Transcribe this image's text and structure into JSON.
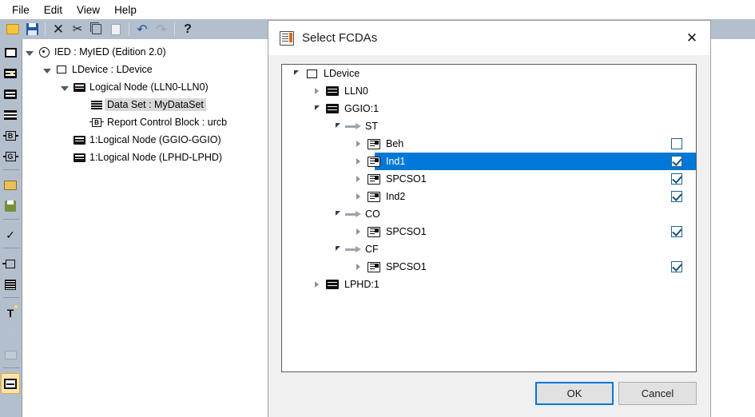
{
  "menubar": {
    "items": [
      {
        "label": "File"
      },
      {
        "label": "Edit"
      },
      {
        "label": "View"
      },
      {
        "label": "Help"
      }
    ]
  },
  "toolbar": {
    "buttons": [
      {
        "name": "open-folder-icon",
        "label": ""
      },
      {
        "name": "save-icon",
        "label": ""
      },
      {
        "name": "delete-icon",
        "label": "✕"
      },
      {
        "name": "cut-icon",
        "label": "✂"
      },
      {
        "name": "copy-icon",
        "label": ""
      },
      {
        "name": "paste-icon",
        "label": ""
      },
      {
        "name": "undo-icon",
        "label": "↶"
      },
      {
        "name": "redo-icon",
        "label": "↷"
      },
      {
        "name": "help-icon",
        "label": "?"
      }
    ]
  },
  "palette": {
    "items": [
      {
        "name": "new-substation-icon"
      },
      {
        "name": "new-folder-icon"
      },
      {
        "name": "folder-icon"
      },
      {
        "name": "data-set-icon"
      },
      {
        "name": "report-control-block-icon"
      },
      {
        "name": "goose-control-block-icon"
      },
      {
        "name": "open-file-icon"
      },
      {
        "name": "save-file-icon"
      },
      {
        "name": "validate-icon"
      },
      {
        "name": "port-icon"
      },
      {
        "name": "table-icon"
      },
      {
        "name": "text-icon"
      },
      {
        "name": "scissors-icon"
      },
      {
        "name": "open-folder-dim-icon"
      },
      {
        "name": "window-icon"
      }
    ]
  },
  "background_tree": {
    "rows": [
      {
        "label": "IED : MyIED (Edition 2.0)",
        "indent": 0,
        "twisty": "open",
        "icon": "ied-icon",
        "selected": false
      },
      {
        "label": "LDevice : LDevice",
        "indent": 1,
        "twisty": "open",
        "icon": "ldevice-icon",
        "selected": false
      },
      {
        "label": "Logical Node (LLN0-LLN0)",
        "indent": 2,
        "twisty": "open",
        "icon": "logical-node-icon",
        "selected": false
      },
      {
        "label": "Data Set : MyDataSet",
        "indent": 3,
        "twisty": "none",
        "icon": "data-set-icon",
        "selected": true
      },
      {
        "label": "Report Control Block : urcb",
        "indent": 3,
        "twisty": "none",
        "icon": "report-control-block-icon",
        "selected": false
      },
      {
        "label": "1:Logical Node (GGIO-GGIO)",
        "indent": 2,
        "twisty": "none",
        "icon": "logical-node-icon",
        "selected": false
      },
      {
        "label": "1:Logical Node (LPHD-LPHD)",
        "indent": 2,
        "twisty": "none",
        "icon": "logical-node-icon",
        "selected": false
      }
    ]
  },
  "dialog": {
    "title": "Select FCDAs",
    "close_label": "✕",
    "tree": {
      "rows": [
        {
          "label": "LDevice",
          "indent": 0,
          "twisty": "open",
          "icon": "ldevice-icon",
          "checkbox": "none",
          "selected": false
        },
        {
          "label": "LLN0",
          "indent": 1,
          "twisty": "closed",
          "icon": "logical-node-icon",
          "checkbox": "none",
          "selected": false
        },
        {
          "label": "GGIO:1",
          "indent": 1,
          "twisty": "open",
          "icon": "logical-node-icon",
          "checkbox": "none",
          "selected": false
        },
        {
          "label": "ST",
          "indent": 2,
          "twisty": "open",
          "icon": "fc-arrow-icon",
          "checkbox": "none",
          "selected": false
        },
        {
          "label": "Beh",
          "indent": 3,
          "twisty": "closed",
          "icon": "data-object-icon",
          "checkbox": "unchecked",
          "selected": false
        },
        {
          "label": "Ind1",
          "indent": 3,
          "twisty": "closed",
          "icon": "data-object-icon",
          "checkbox": "checked",
          "selected": true
        },
        {
          "label": "SPCSO1",
          "indent": 3,
          "twisty": "closed",
          "icon": "data-object-icon",
          "checkbox": "checked",
          "selected": false
        },
        {
          "label": "Ind2",
          "indent": 3,
          "twisty": "closed",
          "icon": "data-object-icon",
          "checkbox": "checked",
          "selected": false
        },
        {
          "label": "CO",
          "indent": 2,
          "twisty": "open",
          "icon": "fc-arrow-icon",
          "checkbox": "none",
          "selected": false
        },
        {
          "label": "SPCSO1",
          "indent": 3,
          "twisty": "closed",
          "icon": "data-object-icon",
          "checkbox": "checked",
          "selected": false
        },
        {
          "label": "CF",
          "indent": 2,
          "twisty": "open",
          "icon": "fc-arrow-icon",
          "checkbox": "none",
          "selected": false
        },
        {
          "label": "SPCSO1",
          "indent": 3,
          "twisty": "closed",
          "icon": "data-object-icon",
          "checkbox": "checked",
          "selected": false
        },
        {
          "label": "LPHD:1",
          "indent": 1,
          "twisty": "closed",
          "icon": "logical-node-icon",
          "checkbox": "none",
          "selected": false
        }
      ]
    },
    "buttons": {
      "ok_label": "OK",
      "cancel_label": "Cancel"
    }
  },
  "colors": {
    "selection_blue": "#0078d7",
    "toolbar_grey": "#b3bfcd",
    "dialog_bg": "#f0f0f0",
    "checkbox_border": "#20638f"
  }
}
